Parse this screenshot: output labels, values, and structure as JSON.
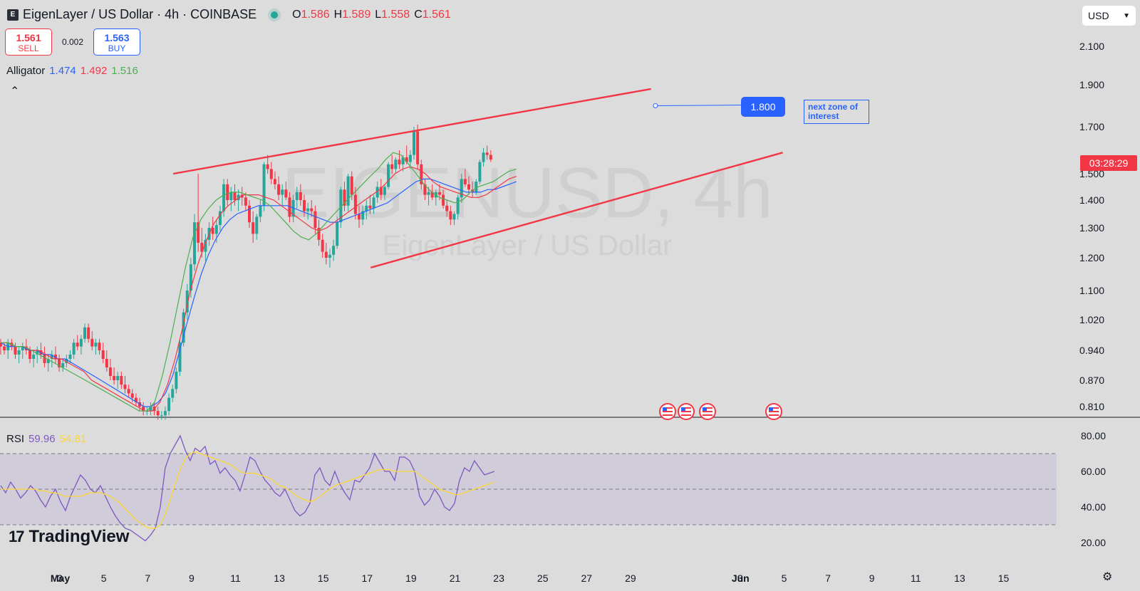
{
  "header": {
    "title": "EigenLayer / US Dollar · 4h · COINBASE",
    "logo_icon": "eigenlayer-logo-icon",
    "ohlc": [
      {
        "k": "O",
        "v": "1.586"
      },
      {
        "k": "H",
        "v": "1.589"
      },
      {
        "k": "L",
        "v": "1.558"
      },
      {
        "k": "C",
        "v": "1.561"
      }
    ]
  },
  "trade": {
    "sell_price": "1.561",
    "sell_label": "SELL",
    "spread": "0.002",
    "buy_price": "1.563",
    "buy_label": "BUY"
  },
  "alligator": {
    "label": "Alligator",
    "jaw": "1.474",
    "teeth": "1.492",
    "lips": "1.516"
  },
  "rsi": {
    "label": "RSI",
    "value": "59.96",
    "ma": "54.81"
  },
  "currency": {
    "value": "USD"
  },
  "watermark": {
    "symbol": "EIGENUSD, 4h",
    "name": "EigenLayer / US Dollar"
  },
  "brand": {
    "name": "TradingView"
  },
  "countdown": "03:28:29",
  "annotation": {
    "price": "1.800",
    "note": "next zone of interest"
  },
  "colors": {
    "up": "#26a69a",
    "down": "#f23645",
    "jaw": "#2962ff",
    "teeth": "#f23645",
    "lips": "#4caf50",
    "rsi": "#7e57c2",
    "rsi_ma": "#fdd835",
    "trend": "#f23645"
  },
  "chart_data": {
    "type": "candlestick",
    "y_ticks": [
      "2.100",
      "1.900",
      "1.700",
      "1.500",
      "1.400",
      "1.300",
      "1.200",
      "1.100",
      "1.020",
      "0.940",
      "0.870",
      "0.810"
    ],
    "x_ticks": [
      "May",
      "3",
      "5",
      "7",
      "9",
      "11",
      "13",
      "15",
      "17",
      "19",
      "21",
      "23",
      "25",
      "27",
      "29",
      "Jun",
      "3",
      "5",
      "7",
      "9",
      "11",
      "13",
      "15"
    ],
    "rsi_ticks": [
      "80.00",
      "60.00",
      "40.00",
      "20.00"
    ],
    "rsi_bands": [
      70,
      50,
      30
    ],
    "trendlines": [
      {
        "x": [
          "May 8",
          "May 30"
        ],
        "y": [
          1.5,
          1.88
        ]
      },
      {
        "x": [
          "May 17",
          "Jun 5"
        ],
        "y": [
          1.17,
          1.59
        ]
      }
    ],
    "candles": [
      [
        0.96,
        0.97,
        0.93,
        0.95
      ],
      [
        0.95,
        0.96,
        0.93,
        0.94
      ],
      [
        0.94,
        0.97,
        0.92,
        0.96
      ],
      [
        0.96,
        0.97,
        0.94,
        0.95
      ],
      [
        0.95,
        0.96,
        0.92,
        0.93
      ],
      [
        0.93,
        0.95,
        0.91,
        0.94
      ],
      [
        0.94,
        0.96,
        0.92,
        0.95
      ],
      [
        0.95,
        0.97,
        0.93,
        0.94
      ],
      [
        0.94,
        0.95,
        0.91,
        0.92
      ],
      [
        0.92,
        0.94,
        0.9,
        0.93
      ],
      [
        0.93,
        0.95,
        0.91,
        0.94
      ],
      [
        0.94,
        0.96,
        0.92,
        0.93
      ],
      [
        0.93,
        0.95,
        0.9,
        0.91
      ],
      [
        0.91,
        0.93,
        0.89,
        0.92
      ],
      [
        0.92,
        0.94,
        0.9,
        0.93
      ],
      [
        0.93,
        0.95,
        0.91,
        0.92
      ],
      [
        0.92,
        0.93,
        0.89,
        0.9
      ],
      [
        0.9,
        0.92,
        0.89,
        0.91
      ],
      [
        0.91,
        0.93,
        0.9,
        0.92
      ],
      [
        0.92,
        0.94,
        0.91,
        0.93
      ],
      [
        0.93,
        0.97,
        0.92,
        0.96
      ],
      [
        0.96,
        0.98,
        0.94,
        0.95
      ],
      [
        0.95,
        0.98,
        0.93,
        0.97
      ],
      [
        0.97,
        1.01,
        0.96,
        1.0
      ],
      [
        1.0,
        1.01,
        0.96,
        0.97
      ],
      [
        0.97,
        0.99,
        0.94,
        0.95
      ],
      [
        0.95,
        0.97,
        0.93,
        0.96
      ],
      [
        0.96,
        0.97,
        0.93,
        0.94
      ],
      [
        0.94,
        0.96,
        0.91,
        0.92
      ],
      [
        0.92,
        0.94,
        0.89,
        0.9
      ],
      [
        0.9,
        0.92,
        0.87,
        0.88
      ],
      [
        0.88,
        0.9,
        0.86,
        0.87
      ],
      [
        0.87,
        0.89,
        0.85,
        0.88
      ],
      [
        0.88,
        0.89,
        0.85,
        0.86
      ],
      [
        0.86,
        0.88,
        0.84,
        0.85
      ],
      [
        0.85,
        0.86,
        0.83,
        0.84
      ],
      [
        0.84,
        0.85,
        0.82,
        0.83
      ],
      [
        0.83,
        0.84,
        0.81,
        0.82
      ],
      [
        0.82,
        0.83,
        0.8,
        0.81
      ],
      [
        0.81,
        0.82,
        0.79,
        0.8
      ],
      [
        0.8,
        0.81,
        0.79,
        0.8
      ],
      [
        0.8,
        0.82,
        0.79,
        0.81
      ],
      [
        0.81,
        0.82,
        0.79,
        0.8
      ],
      [
        0.8,
        0.81,
        0.78,
        0.79
      ],
      [
        0.79,
        0.8,
        0.78,
        0.79
      ],
      [
        0.79,
        0.81,
        0.78,
        0.8
      ],
      [
        0.8,
        0.84,
        0.79,
        0.83
      ],
      [
        0.83,
        0.86,
        0.82,
        0.85
      ],
      [
        0.85,
        0.9,
        0.84,
        0.89
      ],
      [
        0.89,
        0.97,
        0.88,
        0.96
      ],
      [
        0.96,
        1.05,
        0.95,
        1.04
      ],
      [
        1.04,
        1.12,
        1.02,
        1.1
      ],
      [
        1.1,
        1.2,
        1.08,
        1.18
      ],
      [
        1.18,
        1.35,
        1.16,
        1.32
      ],
      [
        1.32,
        1.5,
        1.22,
        1.25
      ],
      [
        1.25,
        1.3,
        1.2,
        1.22
      ],
      [
        1.22,
        1.28,
        1.19,
        1.26
      ],
      [
        1.26,
        1.32,
        1.24,
        1.3
      ],
      [
        1.3,
        1.34,
        1.26,
        1.28
      ],
      [
        1.28,
        1.33,
        1.25,
        1.31
      ],
      [
        1.31,
        1.38,
        1.29,
        1.36
      ],
      [
        1.36,
        1.48,
        1.34,
        1.46
      ],
      [
        1.46,
        1.48,
        1.38,
        1.4
      ],
      [
        1.4,
        1.45,
        1.36,
        1.43
      ],
      [
        1.43,
        1.46,
        1.38,
        1.4
      ],
      [
        1.4,
        1.44,
        1.36,
        1.42
      ],
      [
        1.42,
        1.45,
        1.38,
        1.41
      ],
      [
        1.41,
        1.43,
        1.36,
        1.38
      ],
      [
        1.38,
        1.4,
        1.3,
        1.32
      ],
      [
        1.32,
        1.36,
        1.25,
        1.28
      ],
      [
        1.28,
        1.35,
        1.26,
        1.34
      ],
      [
        1.34,
        1.4,
        1.32,
        1.38
      ],
      [
        1.38,
        1.55,
        1.36,
        1.54
      ],
      [
        1.54,
        1.58,
        1.5,
        1.52
      ],
      [
        1.52,
        1.55,
        1.46,
        1.48
      ],
      [
        1.48,
        1.51,
        1.44,
        1.46
      ],
      [
        1.46,
        1.49,
        1.4,
        1.42
      ],
      [
        1.42,
        1.46,
        1.38,
        1.44
      ],
      [
        1.44,
        1.47,
        1.4,
        1.41
      ],
      [
        1.41,
        1.43,
        1.32,
        1.34
      ],
      [
        1.34,
        1.42,
        1.32,
        1.4
      ],
      [
        1.4,
        1.45,
        1.37,
        1.43
      ],
      [
        1.43,
        1.46,
        1.38,
        1.4
      ],
      [
        1.4,
        1.42,
        1.34,
        1.36
      ],
      [
        1.36,
        1.39,
        1.33,
        1.37
      ],
      [
        1.37,
        1.4,
        1.34,
        1.36
      ],
      [
        1.36,
        1.38,
        1.28,
        1.3
      ],
      [
        1.3,
        1.33,
        1.24,
        1.26
      ],
      [
        1.26,
        1.28,
        1.2,
        1.22
      ],
      [
        1.22,
        1.25,
        1.18,
        1.2
      ],
      [
        1.2,
        1.23,
        1.17,
        1.21
      ],
      [
        1.21,
        1.26,
        1.19,
        1.24
      ],
      [
        1.24,
        1.34,
        1.23,
        1.32
      ],
      [
        1.32,
        1.45,
        1.3,
        1.44
      ],
      [
        1.44,
        1.47,
        1.36,
        1.38
      ],
      [
        1.38,
        1.5,
        1.36,
        1.49
      ],
      [
        1.49,
        1.51,
        1.4,
        1.42
      ],
      [
        1.42,
        1.45,
        1.33,
        1.35
      ],
      [
        1.35,
        1.38,
        1.3,
        1.33
      ],
      [
        1.33,
        1.38,
        1.31,
        1.36
      ],
      [
        1.36,
        1.4,
        1.33,
        1.38
      ],
      [
        1.38,
        1.42,
        1.35,
        1.37
      ],
      [
        1.37,
        1.42,
        1.35,
        1.41
      ],
      [
        1.41,
        1.47,
        1.39,
        1.45
      ],
      [
        1.45,
        1.48,
        1.4,
        1.42
      ],
      [
        1.42,
        1.46,
        1.4,
        1.45
      ],
      [
        1.45,
        1.55,
        1.44,
        1.54
      ],
      [
        1.54,
        1.58,
        1.5,
        1.52
      ],
      [
        1.52,
        1.57,
        1.5,
        1.56
      ],
      [
        1.56,
        1.6,
        1.52,
        1.54
      ],
      [
        1.54,
        1.58,
        1.51,
        1.57
      ],
      [
        1.57,
        1.62,
        1.54,
        1.55
      ],
      [
        1.55,
        1.6,
        1.52,
        1.58
      ],
      [
        1.58,
        1.7,
        1.56,
        1.68
      ],
      [
        1.68,
        1.71,
        1.52,
        1.54
      ],
      [
        1.54,
        1.56,
        1.44,
        1.46
      ],
      [
        1.46,
        1.48,
        1.4,
        1.42
      ],
      [
        1.42,
        1.45,
        1.38,
        1.43
      ],
      [
        1.43,
        1.46,
        1.4,
        1.41
      ],
      [
        1.41,
        1.44,
        1.38,
        1.43
      ],
      [
        1.43,
        1.46,
        1.4,
        1.42
      ],
      [
        1.42,
        1.44,
        1.37,
        1.38
      ],
      [
        1.38,
        1.4,
        1.34,
        1.36
      ],
      [
        1.36,
        1.38,
        1.31,
        1.33
      ],
      [
        1.33,
        1.36,
        1.31,
        1.35
      ],
      [
        1.35,
        1.42,
        1.33,
        1.41
      ],
      [
        1.41,
        1.5,
        1.39,
        1.48
      ],
      [
        1.48,
        1.52,
        1.45,
        1.46
      ],
      [
        1.46,
        1.49,
        1.42,
        1.44
      ],
      [
        1.44,
        1.47,
        1.41,
        1.43
      ],
      [
        1.43,
        1.48,
        1.42,
        1.47
      ],
      [
        1.47,
        1.56,
        1.46,
        1.55
      ],
      [
        1.55,
        1.61,
        1.53,
        1.59
      ],
      [
        1.59,
        1.62,
        1.56,
        1.58
      ],
      [
        1.58,
        1.6,
        1.55,
        1.56
      ]
    ],
    "alligator_series": [
      {
        "name": "jaw",
        "values": [
          0.96,
          0.95,
          0.95,
          0.95,
          0.94,
          0.94,
          0.93,
          0.93,
          0.92,
          0.92,
          0.91,
          0.9,
          0.89,
          0.88,
          0.87,
          0.86,
          0.85,
          0.84,
          0.83,
          0.82,
          0.81,
          0.81,
          0.82,
          0.84,
          0.88,
          0.94,
          1.01,
          1.08,
          1.15,
          1.21,
          1.26,
          1.3,
          1.33,
          1.35,
          1.36,
          1.37,
          1.38,
          1.38,
          1.38,
          1.38,
          1.38,
          1.37,
          1.36,
          1.35,
          1.34,
          1.33,
          1.32,
          1.32,
          1.33,
          1.34,
          1.35,
          1.36,
          1.37,
          1.38,
          1.39,
          1.41,
          1.43,
          1.45,
          1.47,
          1.48,
          1.48,
          1.47,
          1.46,
          1.45,
          1.44,
          1.43,
          1.43,
          1.43,
          1.44,
          1.44,
          1.45,
          1.46,
          1.47
        ]
      },
      {
        "name": "teeth",
        "values": [
          0.96,
          0.96,
          0.95,
          0.95,
          0.94,
          0.94,
          0.93,
          0.92,
          0.92,
          0.91,
          0.9,
          0.89,
          0.87,
          0.86,
          0.85,
          0.84,
          0.83,
          0.82,
          0.81,
          0.8,
          0.8,
          0.82,
          0.86,
          0.92,
          1.0,
          1.1,
          1.18,
          1.25,
          1.31,
          1.35,
          1.38,
          1.4,
          1.42,
          1.42,
          1.42,
          1.41,
          1.4,
          1.38,
          1.36,
          1.34,
          1.32,
          1.3,
          1.29,
          1.3,
          1.32,
          1.34,
          1.36,
          1.38,
          1.4,
          1.42,
          1.44,
          1.47,
          1.5,
          1.52,
          1.53,
          1.52,
          1.5,
          1.47,
          1.45,
          1.44,
          1.43,
          1.42,
          1.41,
          1.41,
          1.42,
          1.44,
          1.46,
          1.48,
          1.49
        ]
      },
      {
        "name": "lips",
        "values": [
          0.96,
          0.96,
          0.95,
          0.95,
          0.94,
          0.93,
          0.92,
          0.91,
          0.9,
          0.89,
          0.88,
          0.87,
          0.86,
          0.85,
          0.84,
          0.83,
          0.82,
          0.81,
          0.8,
          0.8,
          0.82,
          0.88,
          0.96,
          1.06,
          1.17,
          1.27,
          1.33,
          1.37,
          1.4,
          1.42,
          1.43,
          1.43,
          1.42,
          1.41,
          1.4,
          1.38,
          1.35,
          1.32,
          1.29,
          1.27,
          1.26,
          1.28,
          1.31,
          1.34,
          1.37,
          1.4,
          1.43,
          1.46,
          1.49,
          1.52,
          1.56,
          1.59,
          1.58,
          1.54,
          1.5,
          1.46,
          1.43,
          1.41,
          1.4,
          1.39,
          1.4,
          1.43,
          1.45,
          1.46,
          1.47,
          1.49,
          1.51,
          1.52
        ]
      }
    ],
    "rsi_series": [
      {
        "name": "RSI",
        "values": [
          52,
          48,
          54,
          50,
          45,
          48,
          52,
          49,
          44,
          40,
          46,
          50,
          43,
          38,
          46,
          52,
          58,
          55,
          50,
          48,
          52,
          46,
          40,
          35,
          31,
          28,
          27,
          25,
          23,
          21,
          24,
          28,
          40,
          62,
          70,
          75,
          80,
          72,
          66,
          73,
          71,
          74,
          64,
          66,
          59,
          62,
          58,
          55,
          49,
          58,
          68,
          66,
          60,
          55,
          52,
          48,
          46,
          50,
          44,
          38,
          35,
          37,
          42,
          58,
          62,
          55,
          52,
          60,
          53,
          48,
          44,
          55,
          54,
          58,
          62,
          70,
          65,
          60,
          60,
          55,
          68,
          68,
          66,
          60,
          46,
          41,
          44,
          50,
          46,
          40,
          38,
          42,
          55,
          62,
          60,
          66,
          62,
          58,
          59,
          60
        ]
      },
      {
        "name": "MA",
        "values": [
          50,
          50,
          50,
          50,
          50,
          50,
          50,
          50,
          49,
          49,
          48,
          48,
          47,
          46,
          46,
          46,
          46,
          47,
          48,
          48,
          48,
          47,
          46,
          44,
          42,
          39,
          36,
          33,
          31,
          29,
          28,
          28,
          30,
          36,
          44,
          53,
          61,
          67,
          70,
          71,
          70,
          69,
          68,
          67,
          66,
          65,
          64,
          62,
          60,
          59,
          59,
          59,
          58,
          57,
          56,
          54,
          52,
          51,
          49,
          47,
          45,
          44,
          43,
          44,
          46,
          48,
          50,
          52,
          53,
          54,
          55,
          56,
          57,
          58,
          59,
          60,
          61,
          61,
          61,
          60,
          60,
          60,
          60,
          60,
          58,
          56,
          54,
          52,
          50,
          49,
          48,
          47,
          47,
          48,
          49,
          50,
          51,
          52,
          53,
          54
        ]
      }
    ]
  }
}
